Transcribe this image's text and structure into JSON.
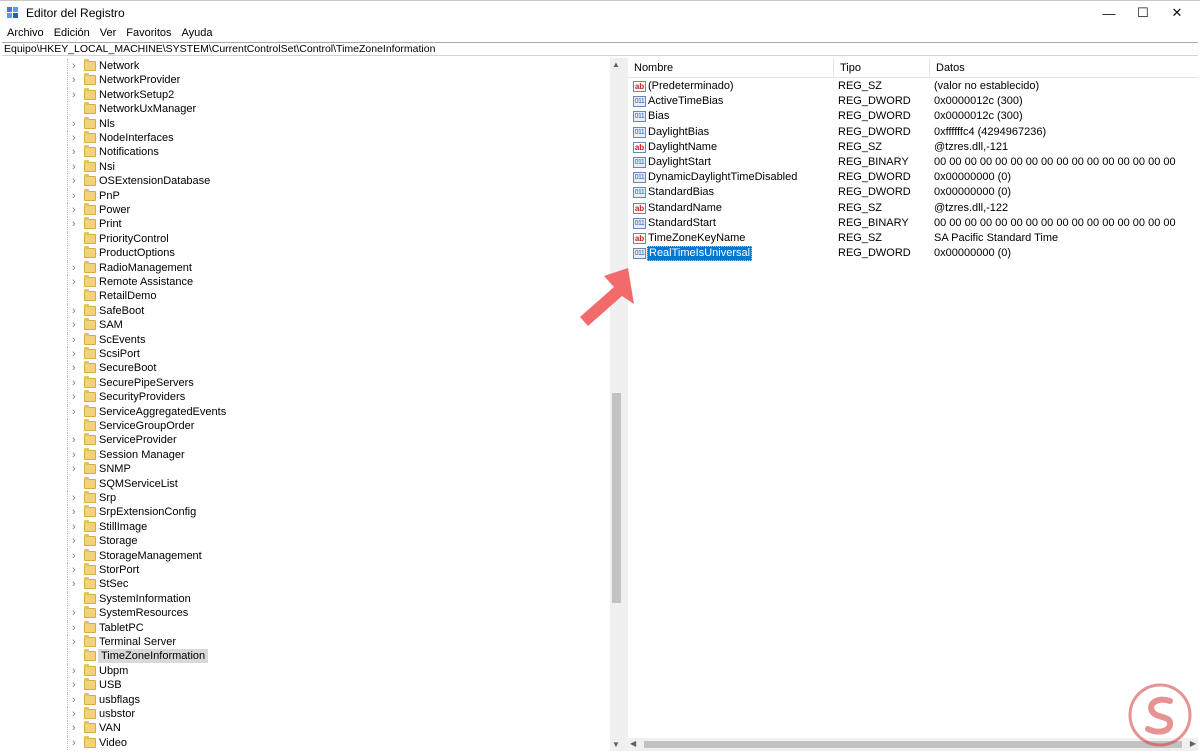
{
  "window": {
    "title": "Editor del Registro",
    "minimize_glyph": "—",
    "maximize_glyph": "☐",
    "close_glyph": "✕"
  },
  "menu": [
    "Archivo",
    "Edición",
    "Ver",
    "Favoritos",
    "Ayuda"
  ],
  "address": "Equipo\\HKEY_LOCAL_MACHINE\\SYSTEM\\CurrentControlSet\\Control\\TimeZoneInformation",
  "tree": {
    "items": [
      {
        "label": "Network",
        "expandable": true
      },
      {
        "label": "NetworkProvider",
        "expandable": true
      },
      {
        "label": "NetworkSetup2",
        "expandable": true
      },
      {
        "label": "NetworkUxManager",
        "expandable": false
      },
      {
        "label": "Nls",
        "expandable": true
      },
      {
        "label": "NodeInterfaces",
        "expandable": true
      },
      {
        "label": "Notifications",
        "expandable": true
      },
      {
        "label": "Nsi",
        "expandable": true
      },
      {
        "label": "OSExtensionDatabase",
        "expandable": true
      },
      {
        "label": "PnP",
        "expandable": true
      },
      {
        "label": "Power",
        "expandable": true
      },
      {
        "label": "Print",
        "expandable": true
      },
      {
        "label": "PriorityControl",
        "expandable": false
      },
      {
        "label": "ProductOptions",
        "expandable": false
      },
      {
        "label": "RadioManagement",
        "expandable": true
      },
      {
        "label": "Remote Assistance",
        "expandable": true
      },
      {
        "label": "RetailDemo",
        "expandable": false
      },
      {
        "label": "SafeBoot",
        "expandable": true
      },
      {
        "label": "SAM",
        "expandable": true
      },
      {
        "label": "ScEvents",
        "expandable": true
      },
      {
        "label": "ScsiPort",
        "expandable": true
      },
      {
        "label": "SecureBoot",
        "expandable": true
      },
      {
        "label": "SecurePipeServers",
        "expandable": true
      },
      {
        "label": "SecurityProviders",
        "expandable": true
      },
      {
        "label": "ServiceAggregatedEvents",
        "expandable": true
      },
      {
        "label": "ServiceGroupOrder",
        "expandable": false
      },
      {
        "label": "ServiceProvider",
        "expandable": true
      },
      {
        "label": "Session Manager",
        "expandable": true
      },
      {
        "label": "SNMP",
        "expandable": true
      },
      {
        "label": "SQMServiceList",
        "expandable": false
      },
      {
        "label": "Srp",
        "expandable": true
      },
      {
        "label": "SrpExtensionConfig",
        "expandable": true
      },
      {
        "label": "StillImage",
        "expandable": true
      },
      {
        "label": "Storage",
        "expandable": true
      },
      {
        "label": "StorageManagement",
        "expandable": true
      },
      {
        "label": "StorPort",
        "expandable": true
      },
      {
        "label": "StSec",
        "expandable": true
      },
      {
        "label": "SystemInformation",
        "expandable": false
      },
      {
        "label": "SystemResources",
        "expandable": true
      },
      {
        "label": "TabletPC",
        "expandable": true
      },
      {
        "label": "Terminal Server",
        "expandable": true
      },
      {
        "label": "TimeZoneInformation",
        "expandable": false,
        "selected": true
      },
      {
        "label": "Ubpm",
        "expandable": true
      },
      {
        "label": "USB",
        "expandable": true
      },
      {
        "label": "usbflags",
        "expandable": true
      },
      {
        "label": "usbstor",
        "expandable": true
      },
      {
        "label": "VAN",
        "expandable": true
      },
      {
        "label": "Video",
        "expandable": true
      }
    ]
  },
  "list": {
    "headers": {
      "name": "Nombre",
      "type": "Tipo",
      "data": "Datos"
    },
    "rows": [
      {
        "icon": "string-value-icon",
        "name": "(Predeterminado)",
        "type": "REG_SZ",
        "data": "(valor no establecido)"
      },
      {
        "icon": "binary-value-icon",
        "name": "ActiveTimeBias",
        "type": "REG_DWORD",
        "data": "0x0000012c (300)"
      },
      {
        "icon": "binary-value-icon",
        "name": "Bias",
        "type": "REG_DWORD",
        "data": "0x0000012c (300)"
      },
      {
        "icon": "binary-value-icon",
        "name": "DaylightBias",
        "type": "REG_DWORD",
        "data": "0xffffffc4 (4294967236)"
      },
      {
        "icon": "string-value-icon",
        "name": "DaylightName",
        "type": "REG_SZ",
        "data": "@tzres.dll,-121"
      },
      {
        "icon": "binary-value-icon",
        "name": "DaylightStart",
        "type": "REG_BINARY",
        "data": "00 00 00 00 00 00 00 00 00 00 00 00 00 00 00 00"
      },
      {
        "icon": "binary-value-icon",
        "name": "DynamicDaylightTimeDisabled",
        "type": "REG_DWORD",
        "data": "0x00000000 (0)"
      },
      {
        "icon": "binary-value-icon",
        "name": "StandardBias",
        "type": "REG_DWORD",
        "data": "0x00000000 (0)"
      },
      {
        "icon": "string-value-icon",
        "name": "StandardName",
        "type": "REG_SZ",
        "data": "@tzres.dll,-122"
      },
      {
        "icon": "binary-value-icon",
        "name": "StandardStart",
        "type": "REG_BINARY",
        "data": "00 00 00 00 00 00 00 00 00 00 00 00 00 00 00 00"
      },
      {
        "icon": "string-value-icon",
        "name": "TimeZoneKeyName",
        "type": "REG_SZ",
        "data": "SA Pacific Standard Time"
      },
      {
        "icon": "binary-value-icon",
        "name": "RealTimeIsUniversal",
        "type": "REG_DWORD",
        "data": "0x00000000 (0)",
        "selected": true
      }
    ]
  },
  "icons": {
    "string_glyph": "ab",
    "binary_glyph": "011 110",
    "expand_glyph": "›",
    "scroll_up_glyph": "▲",
    "scroll_down_glyph": "▼",
    "scroll_left_glyph": "◀",
    "scroll_right_glyph": "▶"
  },
  "colors": {
    "selection": "#0078d7",
    "tree_selection": "#d9d9d9",
    "folder": "#f2d27a",
    "annotation_arrow": "#f26b6b",
    "watermark": "#d23a3a"
  }
}
